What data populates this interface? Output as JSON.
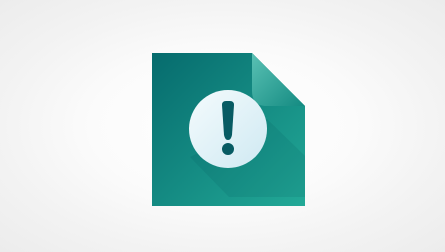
{
  "icon": {
    "name": "file-warning-icon",
    "symbol": "!",
    "colors": {
      "background": "#ffffff",
      "page_top": "#066b6d",
      "page_bottom": "#22a997",
      "badge_fill": "#dff1f8",
      "badge_mark": "#075b63"
    }
  }
}
